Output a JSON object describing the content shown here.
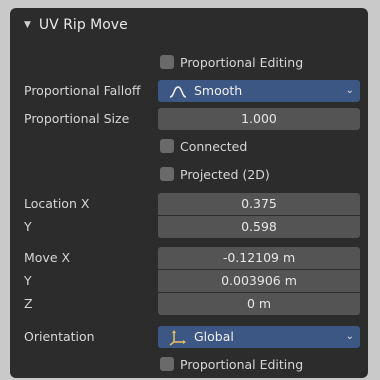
{
  "panel": {
    "title": "UV Rip Move",
    "proportional_editing_top": "Proportional Editing",
    "proportional_falloff": {
      "label": "Proportional Falloff",
      "value": "Smooth",
      "icon": "smooth-falloff-icon"
    },
    "proportional_size": {
      "label": "Proportional Size",
      "value": "1.000"
    },
    "connected": "Connected",
    "projected": "Projected (2D)",
    "location": {
      "x_label": "Location X",
      "x_value": "0.375",
      "y_label": "Y",
      "y_value": "0.598"
    },
    "move": {
      "x_label": "Move X",
      "x_value": "-0.12109 m",
      "y_label": "Y",
      "y_value": "0.003906 m",
      "z_label": "Z",
      "z_value": "0 m"
    },
    "orientation": {
      "label": "Orientation",
      "value": "Global",
      "icon": "axes-gizmo-icon"
    },
    "proportional_editing_bottom": "Proportional Editing"
  },
  "colors": {
    "panel_bg": "#2c2c2c",
    "field_bg": "#545454",
    "dropdown_bg": "#3c5784",
    "checkbox_bg": "#6a6a6a"
  }
}
